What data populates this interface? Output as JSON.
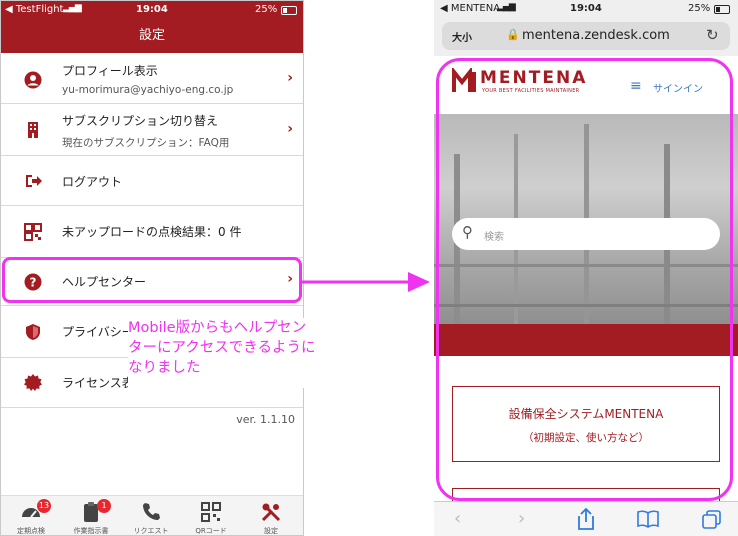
{
  "left": {
    "status": {
      "app": "TestFlight",
      "time": "19:04",
      "battery": "25%"
    },
    "header_title": "設定",
    "menu": {
      "profile_title": "プロフィール表示",
      "profile_sub": "yu-morimura@yachiyo-eng.co.jp",
      "subscription_title": "サブスクリプション切り替え",
      "subscription_sub": "現在のサブスクリプション：FAQ用",
      "logout": "ログアウト",
      "unuploaded": "未アップロードの点検結果：0 件",
      "help": "ヘルプセンター",
      "privacy": "プライバシー",
      "license": "ライセンス表"
    },
    "version": "ver. 1.1.10",
    "tabs": [
      {
        "label": "定期点検",
        "badge": "13"
      },
      {
        "label": "作業指示書",
        "badge": "1"
      },
      {
        "label": "リクエスト"
      },
      {
        "label": "QRコード"
      },
      {
        "label": "設定"
      }
    ]
  },
  "annotation": {
    "line1": "Mobile版からもヘルプセン",
    "line2": "ターにアクセスできるように",
    "line3": "なりました"
  },
  "right": {
    "status": {
      "app": "MENTENA",
      "time": "19:04",
      "battery": "25%"
    },
    "aa": "大小",
    "url": "mentena.zendesk.com",
    "brand": "MENTENA",
    "brand_tag": "YOUR BEST FACILITIES MAINTAINER",
    "signin": "サインイン",
    "search_placeholder": "検索",
    "card_title": "設備保全システムMENTENA",
    "card_sub": "（初期設定、使い方など）"
  },
  "colors": {
    "brand_red": "#a31c21",
    "highlight": "#f033f0"
  }
}
